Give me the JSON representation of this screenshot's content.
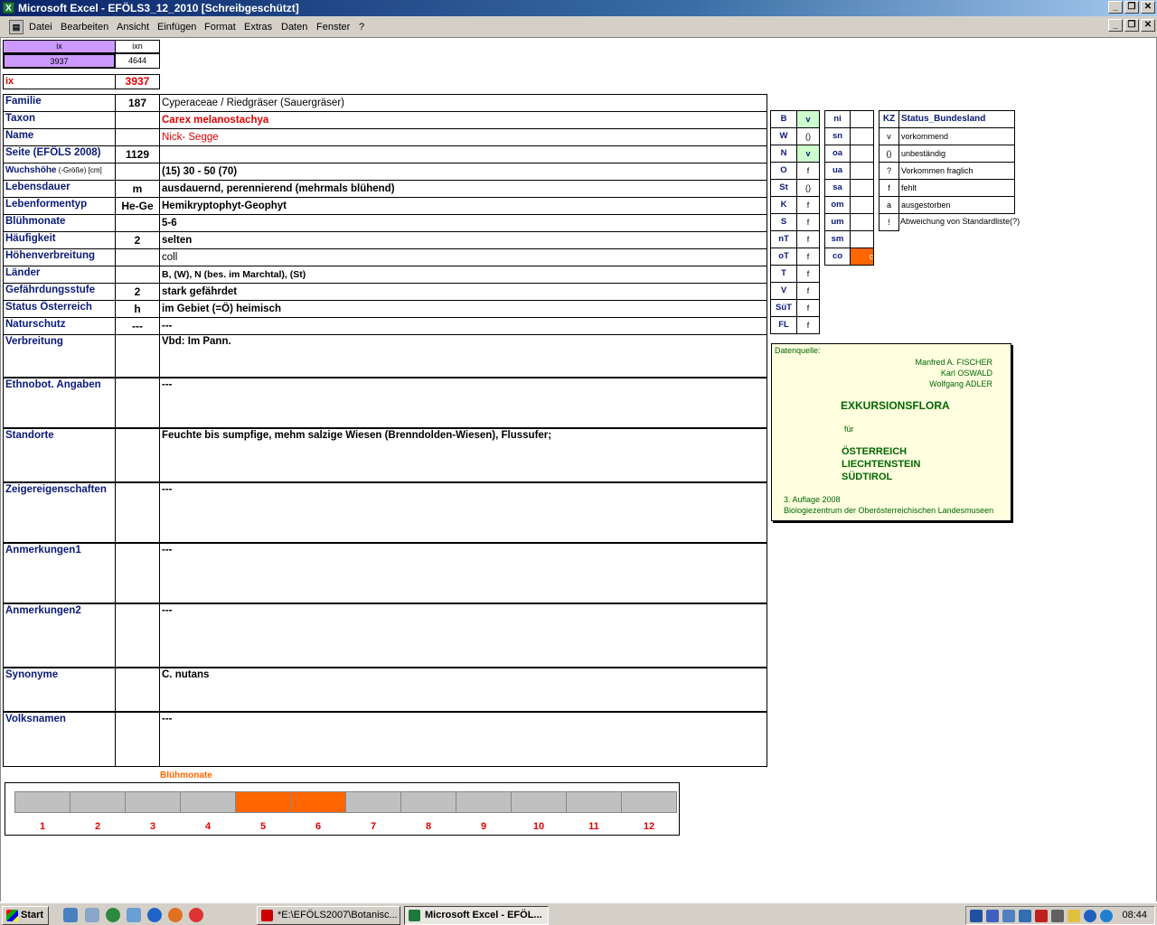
{
  "window": {
    "title": "Microsoft Excel - EFÖLS3_12_2010  [Schreibgeschützt]",
    "excel_icon": "X"
  },
  "menu": [
    "Datei",
    "Bearbeiten",
    "Ansicht",
    "Einfügen",
    "Format",
    "Extras",
    "Daten",
    "Fenster",
    "?"
  ],
  "top": {
    "ix_header": "ix",
    "ixn_header": "ixn",
    "ix_value": "3937",
    "ixn_value": "4644",
    "ix_label": "ix",
    "ix_big": "3937"
  },
  "rows": [
    {
      "label": "Familie",
      "num": "187",
      "value": "Cyperaceae  /  Riedgräser (Sauergräser)"
    },
    {
      "label": "Taxon",
      "num": "",
      "value": "Carex melanostachya"
    },
    {
      "label": "Name",
      "num": "",
      "value": "Nick- Segge"
    },
    {
      "label": "Seite (EFÖLS 2008)",
      "num": "1129",
      "value": ""
    },
    {
      "label": "Wuchshöhe",
      "label_suffix": " (-Größe) [cm]",
      "num": "",
      "value": " (15) 30 - 50 (70)"
    },
    {
      "label": "Lebensdauer",
      "num": "m",
      "value": "ausdauernd, perennierend (mehrmals blühend)"
    },
    {
      "label": "Lebenformentyp",
      "num": "He-Ge",
      "value": "Hemikryptophyt-Geophyt"
    },
    {
      "label": "Blühmonate",
      "num": "",
      "value": " 5-6"
    },
    {
      "label": "Häufigkeit",
      "num": "2",
      "value": "selten"
    },
    {
      "label": "Höhenverbreitung",
      "num": "",
      "value": "coll"
    },
    {
      "label": "Länder",
      "num": "",
      "value": "B, (W), N (bes. im Marchtal), (St)"
    },
    {
      "label": "Gefährdungsstufe",
      "num": "2",
      "value": "stark gefährdet"
    },
    {
      "label": "Status Österreich",
      "num": "h",
      "value": "im Gebiet (=Ö) heimisch"
    },
    {
      "label": "Naturschutz",
      "num": "---",
      "value": " ---"
    }
  ],
  "big_rows": [
    {
      "label": "Verbreitung",
      "value": "Vbd: Im Pann."
    },
    {
      "label": "Ethnobot. Angaben",
      "value": "---"
    },
    {
      "label": "Standorte",
      "value": "Feuchte bis sumpfige, mehm salzige Wiesen (Brenndolden-Wiesen), Flussufer;"
    },
    {
      "label": "Zeigereigenschaften",
      "value": "---"
    },
    {
      "label": "Anmerkungen1",
      "value": "---"
    },
    {
      "label": "Anmerkungen2",
      "value": "---"
    },
    {
      "label": "Synonyme",
      "value": "C. nutans"
    },
    {
      "label": "Volksnamen",
      "value": "---"
    }
  ],
  "states": [
    {
      "k": "B",
      "v": "v",
      "hl": true
    },
    {
      "k": "W",
      "v": "()",
      "hl": false
    },
    {
      "k": "N",
      "v": "v",
      "hl": true
    },
    {
      "k": "O",
      "v": "f",
      "hl": false
    },
    {
      "k": "St",
      "v": "()",
      "hl": false
    },
    {
      "k": "K",
      "v": "f",
      "hl": false
    },
    {
      "k": "S",
      "v": "f",
      "hl": false
    },
    {
      "k": "nT",
      "v": "f",
      "hl": false
    },
    {
      "k": "oT",
      "v": "f",
      "hl": false
    },
    {
      "k": "T",
      "v": "f",
      "hl": false
    },
    {
      "k": "V",
      "v": "f",
      "hl": false
    },
    {
      "k": "SüT",
      "v": "f",
      "hl": false
    },
    {
      "k": "FL",
      "v": "f",
      "hl": false
    }
  ],
  "alt_zones": [
    {
      "k": "ni",
      "v": "",
      "hl": false
    },
    {
      "k": "sn",
      "v": "",
      "hl": false
    },
    {
      "k": "oa",
      "v": "",
      "hl": false
    },
    {
      "k": "ua",
      "v": "",
      "hl": false
    },
    {
      "k": "sa",
      "v": "",
      "hl": false
    },
    {
      "k": "om",
      "v": "",
      "hl": false
    },
    {
      "k": "um",
      "v": "",
      "hl": false
    },
    {
      "k": "sm",
      "v": "",
      "hl": false
    },
    {
      "k": "co",
      "v": "c",
      "hl": true
    }
  ],
  "legend": {
    "header_k": "KZ",
    "header_v": "Status_Bundesland",
    "items": [
      {
        "k": "v",
        "v": "vorkommend"
      },
      {
        "k": "()",
        "v": "unbeständig"
      },
      {
        "k": "?",
        "v": "Vorkommen fraglich"
      },
      {
        "k": "f",
        "v": "fehlt"
      },
      {
        "k": "a",
        "v": "ausgestorben"
      },
      {
        "k": "!",
        "v": "Abweichung von Standardliste(?)"
      }
    ]
  },
  "source": {
    "label": "Datenquelle:",
    "authors": [
      "Manfred A. FISCHER",
      "Karl OSWALD",
      "Wolfgang ADLER"
    ],
    "title": "EXKURSIONSFLORA",
    "fuer": "für",
    "countries": [
      "ÖSTERREICH",
      "LIECHTENSTEIN",
      "SÜDTIROL"
    ],
    "edition": "3. Auflage 2008",
    "publisher": "Biologiezentrum der Oberösterreichischen Landesmuseen"
  },
  "bloom": {
    "title": "Blühmonate",
    "months": [
      "1",
      "2",
      "3",
      "4",
      "5",
      "6",
      "7",
      "8",
      "9",
      "10",
      "11",
      "12"
    ],
    "active": [
      5,
      6
    ]
  },
  "colors": {
    "accent_orange": "#ff6600",
    "highlight_green": "#ccffcc",
    "purple": "#cc99ff",
    "label_blue": "#0a1a7a",
    "red": "#e00000",
    "source_bg": "#ffffe0",
    "source_text": "#006600"
  },
  "taskbar": {
    "start": "Start",
    "tasks": [
      "*E:\\EFÖLS2007\\Botanisc...",
      "Microsoft Excel - EFÖL..."
    ],
    "clock": "08:44"
  }
}
